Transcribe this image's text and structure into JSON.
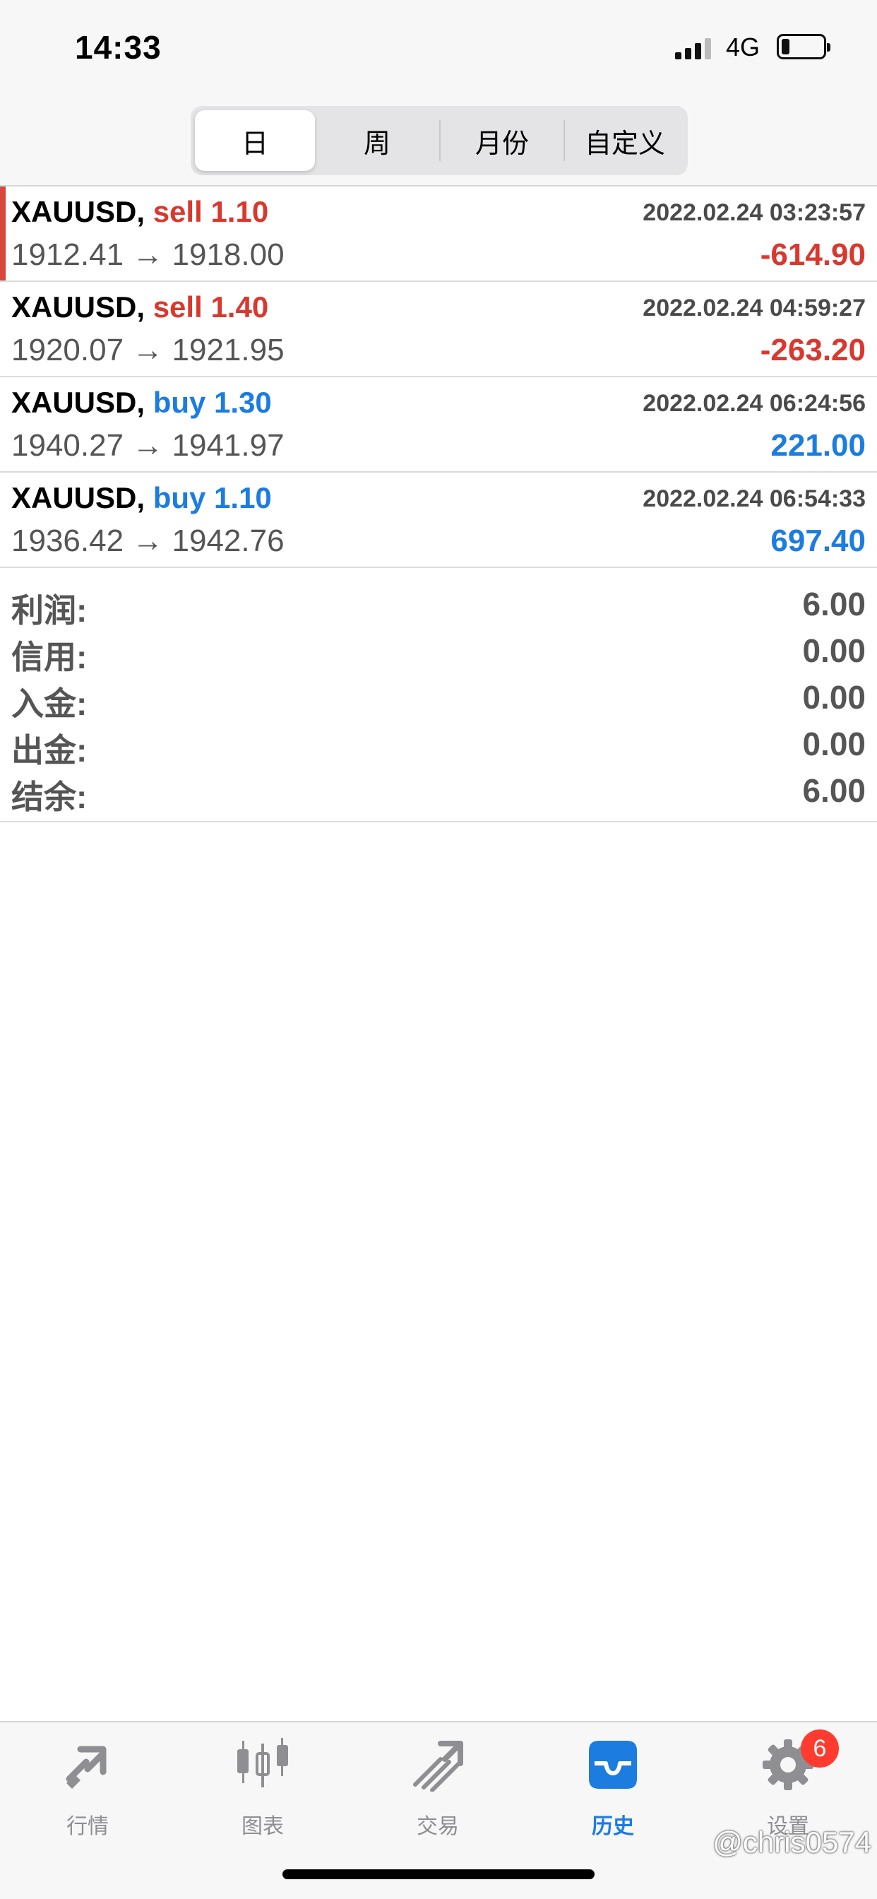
{
  "status_bar": {
    "time": "14:33",
    "network": "4G"
  },
  "segments": [
    {
      "label": "日",
      "active": true
    },
    {
      "label": "周",
      "active": false
    },
    {
      "label": "月份",
      "active": false
    },
    {
      "label": "自定义",
      "active": false
    }
  ],
  "deals": [
    {
      "symbol": "XAUUSD,",
      "type": "sell",
      "volume": "1.10",
      "time": "2022.02.24 03:23:57",
      "prices": "1912.41 → 1918.00",
      "profit": "-614.90"
    },
    {
      "symbol": "XAUUSD,",
      "type": "sell",
      "volume": "1.40",
      "time": "2022.02.24 04:59:27",
      "prices": "1920.07 → 1921.95",
      "profit": "-263.20"
    },
    {
      "symbol": "XAUUSD,",
      "type": "buy",
      "volume": "1.30",
      "time": "2022.02.24 06:24:56",
      "prices": "1940.27 → 1941.97",
      "profit": "221.00"
    },
    {
      "symbol": "XAUUSD,",
      "type": "buy",
      "volume": "1.10",
      "time": "2022.02.24 06:54:33",
      "prices": "1936.42 → 1942.76",
      "profit": "697.40"
    }
  ],
  "summary": [
    {
      "label": "利润:",
      "value": "6.00"
    },
    {
      "label": "信用:",
      "value": "0.00"
    },
    {
      "label": "入金:",
      "value": "0.00"
    },
    {
      "label": "出金:",
      "value": "0.00"
    },
    {
      "label": "结余:",
      "value": "6.00"
    }
  ],
  "tabs": [
    {
      "label": "行情",
      "icon": "quotes-icon",
      "active": false
    },
    {
      "label": "图表",
      "icon": "chart-icon",
      "active": false
    },
    {
      "label": "交易",
      "icon": "trade-icon",
      "active": false
    },
    {
      "label": "历史",
      "icon": "history-icon",
      "active": true
    },
    {
      "label": "设置",
      "icon": "gear-icon",
      "active": false,
      "badge": "6"
    }
  ],
  "watermark": "@chris0574",
  "colors": {
    "sell": "#d9382f",
    "buy": "#1c7ce0",
    "active_tab": "#1c7ce0",
    "inactive_tab": "#8e8e93",
    "badge": "#ff3b30"
  }
}
